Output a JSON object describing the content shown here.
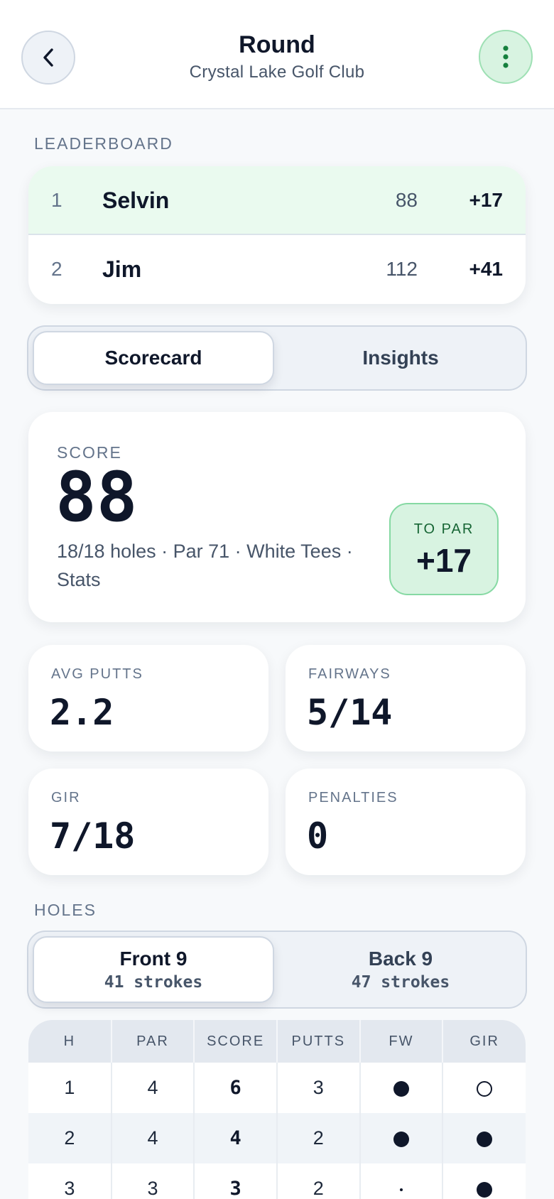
{
  "header": {
    "title": "Round",
    "subtitle": "Crystal Lake Golf Club"
  },
  "leaderboard": {
    "label": "LEADERBOARD",
    "rows": [
      {
        "rank": "1",
        "name": "Selvin",
        "score": "88",
        "to_par": "+17"
      },
      {
        "rank": "2",
        "name": "Jim",
        "score": "112",
        "to_par": "+41"
      }
    ]
  },
  "view_tabs": {
    "scorecard": "Scorecard",
    "insights": "Insights",
    "selected": "Scorecard"
  },
  "score_card": {
    "label": "SCORE",
    "value": "88",
    "meta": "18/18 holes · Par 71 · White Tees · Stats",
    "to_par_label": "TO PAR",
    "to_par_value": "+17"
  },
  "stats": [
    {
      "label": "AVG PUTTS",
      "value": "2.2"
    },
    {
      "label": "FAIRWAYS",
      "value": "5/14"
    },
    {
      "label": "GIR",
      "value": "7/18"
    },
    {
      "label": "PENALTIES",
      "value": "0"
    }
  ],
  "holes": {
    "label": "HOLES",
    "tabs": [
      {
        "label": "Front 9",
        "strokes": "41 strokes"
      },
      {
        "label": "Back 9",
        "strokes": "47 strokes"
      }
    ],
    "selected": "Front 9",
    "columns": [
      "H",
      "PAR",
      "SCORE",
      "PUTTS",
      "FW",
      "GIR"
    ],
    "rows": [
      {
        "hole": "1",
        "par": "4",
        "score": "6",
        "putts": "3",
        "fw": "hit",
        "gir": "miss"
      },
      {
        "hole": "2",
        "par": "4",
        "score": "4",
        "putts": "2",
        "fw": "hit",
        "gir": "hit"
      },
      {
        "hole": "3",
        "par": "3",
        "score": "3",
        "putts": "2",
        "fw": "na",
        "gir": "hit"
      }
    ]
  },
  "colors": {
    "accent_green": "#d8f3e1",
    "leader_row": "#eafaef",
    "text_primary": "#0f172a"
  },
  "icons": {
    "back": "chevron-left-icon",
    "more": "more-vertical-icon"
  }
}
